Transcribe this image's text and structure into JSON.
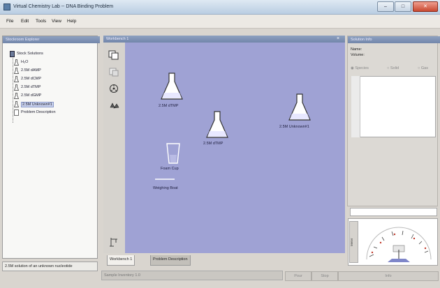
{
  "window": {
    "title": "Virtual Chemistry Lab -- DNA Binding Problem",
    "controls": {
      "minimize": "–",
      "maximize": "□",
      "close": "✕"
    }
  },
  "menu": [
    "File",
    "Edit",
    "Tools",
    "View",
    "Help"
  ],
  "explorer": {
    "title": "Stockroom Explorer",
    "root": "Stock Solutions",
    "items": [
      "H₂O",
      "2.5M dAMP",
      "2.5M dCMP",
      "2.5M dTMP",
      "2.5M dGMP",
      "2.5M Unknown#1",
      "Problem Description"
    ],
    "status": "2.5M solution of an unknown nucleotide"
  },
  "workbench": {
    "title": "Workbench 1",
    "close": "×",
    "flasks": [
      "2.5M dTMP",
      "2.5M dTMP",
      "2.5M Unknown#1"
    ],
    "beaker_label": "Foam Cup",
    "pad_label": "Weighing Boat",
    "tabs": [
      "Workbench 1",
      "Problem Description"
    ]
  },
  "statusbar": {
    "field": "Sample Inventory 1.0",
    "buttons": [
      "Pour",
      "Stop",
      "Info"
    ]
  },
  "solution": {
    "title": "Solution Info",
    "name_label": "Name:",
    "volume_label": "Volume:",
    "radios": [
      "Species",
      "Solid",
      "Gas"
    ],
    "meter_label": "Meter"
  },
  "colors": {
    "canvas": "#9fa2d4",
    "panel_head": "#7d90b4"
  }
}
